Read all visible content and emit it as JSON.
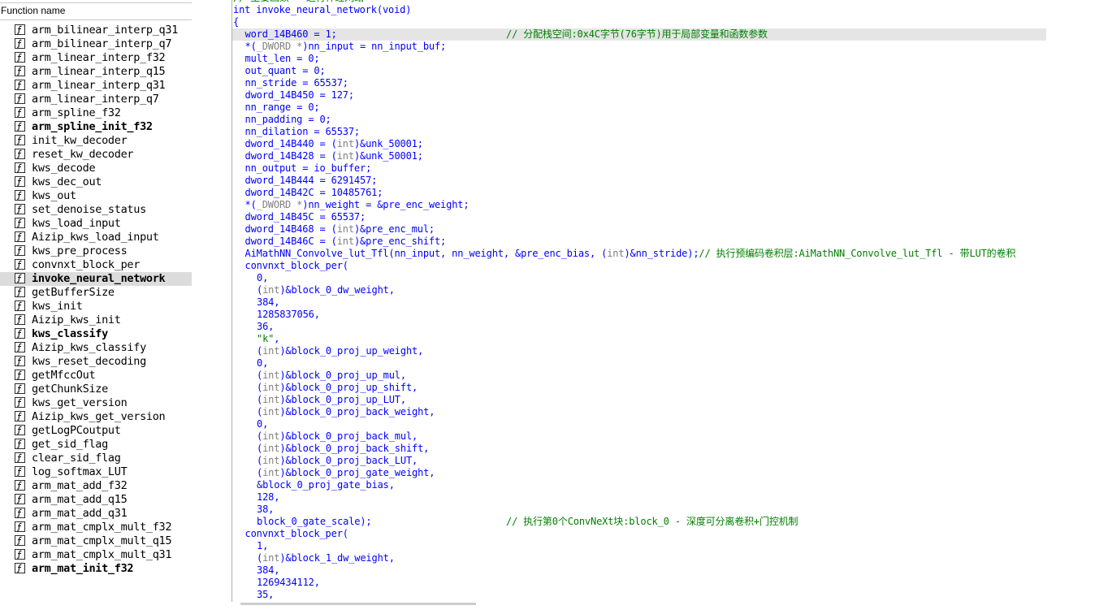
{
  "function_panel": {
    "header": "Function name",
    "items": [
      {
        "name": "arm_bilinear_interp_q31",
        "bold": false,
        "selected": false
      },
      {
        "name": "arm_bilinear_interp_q7",
        "bold": false,
        "selected": false
      },
      {
        "name": "arm_linear_interp_f32",
        "bold": false,
        "selected": false
      },
      {
        "name": "arm_linear_interp_q15",
        "bold": false,
        "selected": false
      },
      {
        "name": "arm_linear_interp_q31",
        "bold": false,
        "selected": false
      },
      {
        "name": "arm_linear_interp_q7",
        "bold": false,
        "selected": false
      },
      {
        "name": "arm_spline_f32",
        "bold": false,
        "selected": false
      },
      {
        "name": "arm_spline_init_f32",
        "bold": true,
        "selected": false
      },
      {
        "name": "init_kw_decoder",
        "bold": false,
        "selected": false
      },
      {
        "name": "reset_kw_decoder",
        "bold": false,
        "selected": false
      },
      {
        "name": "kws_decode",
        "bold": false,
        "selected": false
      },
      {
        "name": "kws_dec_out",
        "bold": false,
        "selected": false
      },
      {
        "name": "kws_out",
        "bold": false,
        "selected": false
      },
      {
        "name": "set_denoise_status",
        "bold": false,
        "selected": false
      },
      {
        "name": "kws_load_input",
        "bold": false,
        "selected": false
      },
      {
        "name": "Aizip_kws_load_input",
        "bold": false,
        "selected": false
      },
      {
        "name": "kws_pre_process",
        "bold": false,
        "selected": false
      },
      {
        "name": "convnxt_block_per",
        "bold": false,
        "selected": false
      },
      {
        "name": "invoke_neural_network",
        "bold": true,
        "selected": true
      },
      {
        "name": "getBufferSize",
        "bold": false,
        "selected": false
      },
      {
        "name": "kws_init",
        "bold": false,
        "selected": false
      },
      {
        "name": "Aizip_kws_init",
        "bold": false,
        "selected": false
      },
      {
        "name": "kws_classify",
        "bold": true,
        "selected": false
      },
      {
        "name": "Aizip_kws_classify",
        "bold": false,
        "selected": false
      },
      {
        "name": "kws_reset_decoding",
        "bold": false,
        "selected": false
      },
      {
        "name": "getMfccOut",
        "bold": false,
        "selected": false
      },
      {
        "name": "getChunkSize",
        "bold": false,
        "selected": false
      },
      {
        "name": "kws_get_version",
        "bold": false,
        "selected": false
      },
      {
        "name": "Aizip_kws_get_version",
        "bold": false,
        "selected": false
      },
      {
        "name": "getLogPCoutput",
        "bold": false,
        "selected": false
      },
      {
        "name": "get_sid_flag",
        "bold": false,
        "selected": false
      },
      {
        "name": "clear_sid_flag",
        "bold": false,
        "selected": false
      },
      {
        "name": "log_softmax_LUT",
        "bold": false,
        "selected": false
      },
      {
        "name": "arm_mat_add_f32",
        "bold": false,
        "selected": false
      },
      {
        "name": "arm_mat_add_q15",
        "bold": false,
        "selected": false
      },
      {
        "name": "arm_mat_add_q31",
        "bold": false,
        "selected": false
      },
      {
        "name": "arm_mat_cmplx_mult_f32",
        "bold": false,
        "selected": false
      },
      {
        "name": "arm_mat_cmplx_mult_q15",
        "bold": false,
        "selected": false
      },
      {
        "name": "arm_mat_cmplx_mult_q31",
        "bold": false,
        "selected": false
      },
      {
        "name": "arm_mat_init_f32",
        "bold": true,
        "selected": false
      }
    ]
  },
  "code_panel": {
    "lines": [
      {
        "indent": 0,
        "parts": [
          {
            "t": "// 主要函数 - 运行神经网络",
            "c": "cmt"
          }
        ]
      },
      {
        "indent": 0,
        "parts": [
          {
            "t": "int invoke_neural_network(void)"
          }
        ]
      },
      {
        "indent": 0,
        "parts": [
          {
            "t": "{"
          }
        ]
      },
      {
        "indent": 2,
        "highlight": true,
        "parts": [
          {
            "t": "word_14B460 = 1;"
          }
        ],
        "comment": "// 分配栈空间:0x4C字节(76字节)用于局部变量和函数参数"
      },
      {
        "indent": 2,
        "parts": [
          {
            "t": "*("
          },
          {
            "t": "_DWORD *",
            "c": "cast"
          },
          {
            "t": ")nn_input = nn_input_buf;"
          }
        ]
      },
      {
        "indent": 2,
        "parts": [
          {
            "t": "mult_len = 0;"
          }
        ]
      },
      {
        "indent": 2,
        "parts": [
          {
            "t": "out_quant = 0;"
          }
        ]
      },
      {
        "indent": 2,
        "parts": [
          {
            "t": "nn_stride = 65537;"
          }
        ]
      },
      {
        "indent": 2,
        "parts": [
          {
            "t": "dword_14B450 = 127;"
          }
        ]
      },
      {
        "indent": 2,
        "parts": [
          {
            "t": "nn_range = 0;"
          }
        ]
      },
      {
        "indent": 2,
        "parts": [
          {
            "t": "nn_padding = 0;"
          }
        ]
      },
      {
        "indent": 2,
        "parts": [
          {
            "t": "nn_dilation = 65537;"
          }
        ]
      },
      {
        "indent": 2,
        "parts": [
          {
            "t": "dword_14B440 = ("
          },
          {
            "t": "int",
            "c": "cast"
          },
          {
            "t": ")&unk_50001;"
          }
        ]
      },
      {
        "indent": 2,
        "parts": [
          {
            "t": "dword_14B428 = ("
          },
          {
            "t": "int",
            "c": "cast"
          },
          {
            "t": ")&unk_50001;"
          }
        ]
      },
      {
        "indent": 2,
        "parts": [
          {
            "t": "nn_output = io_buffer;"
          }
        ]
      },
      {
        "indent": 2,
        "parts": [
          {
            "t": "dword_14B444 = 6291457;"
          }
        ]
      },
      {
        "indent": 2,
        "parts": [
          {
            "t": "dword_14B42C = 10485761;"
          }
        ]
      },
      {
        "indent": 2,
        "parts": [
          {
            "t": "*("
          },
          {
            "t": "_DWORD *",
            "c": "cast"
          },
          {
            "t": ")nn_weight = &pre_enc_weight;"
          }
        ]
      },
      {
        "indent": 2,
        "parts": [
          {
            "t": "dword_14B45C = 65537;"
          }
        ]
      },
      {
        "indent": 2,
        "parts": [
          {
            "t": "dword_14B468 = ("
          },
          {
            "t": "int",
            "c": "cast"
          },
          {
            "t": ")&pre_enc_mul;"
          }
        ]
      },
      {
        "indent": 2,
        "parts": [
          {
            "t": "dword_14B46C = ("
          },
          {
            "t": "int",
            "c": "cast"
          },
          {
            "t": ")&pre_enc_shift;"
          }
        ]
      },
      {
        "indent": 2,
        "parts": [
          {
            "t": "AiMathNN_Convolve_lut_Tfl(nn_input, nn_weight, &pre_enc_bias, ("
          },
          {
            "t": "int",
            "c": "cast"
          },
          {
            "t": ")&nn_stride);"
          },
          {
            "t": "// 执行预编码卷积层:AiMathNN_Convolve_lut_Tfl - 带LUT的卷积",
            "c": "cmt"
          }
        ]
      },
      {
        "indent": 2,
        "parts": [
          {
            "t": "convnxt_block_per("
          }
        ]
      },
      {
        "indent": 4,
        "parts": [
          {
            "t": "0,"
          }
        ]
      },
      {
        "indent": 4,
        "parts": [
          {
            "t": "("
          },
          {
            "t": "int",
            "c": "cast"
          },
          {
            "t": ")&block_0_dw_weight,"
          }
        ]
      },
      {
        "indent": 4,
        "parts": [
          {
            "t": "384,"
          }
        ]
      },
      {
        "indent": 4,
        "parts": [
          {
            "t": "1285837056,"
          }
        ]
      },
      {
        "indent": 4,
        "parts": [
          {
            "t": "36,"
          }
        ]
      },
      {
        "indent": 4,
        "parts": [
          {
            "t": "\"k\"",
            "c": "str"
          },
          {
            "t": ","
          }
        ]
      },
      {
        "indent": 4,
        "parts": [
          {
            "t": "("
          },
          {
            "t": "int",
            "c": "cast"
          },
          {
            "t": ")&block_0_proj_up_weight,"
          }
        ]
      },
      {
        "indent": 4,
        "parts": [
          {
            "t": "0,"
          }
        ]
      },
      {
        "indent": 4,
        "parts": [
          {
            "t": "("
          },
          {
            "t": "int",
            "c": "cast"
          },
          {
            "t": ")&block_0_proj_up_mul,"
          }
        ]
      },
      {
        "indent": 4,
        "parts": [
          {
            "t": "("
          },
          {
            "t": "int",
            "c": "cast"
          },
          {
            "t": ")&block_0_proj_up_shift,"
          }
        ]
      },
      {
        "indent": 4,
        "parts": [
          {
            "t": "("
          },
          {
            "t": "int",
            "c": "cast"
          },
          {
            "t": ")&block_0_proj_up_LUT,"
          }
        ]
      },
      {
        "indent": 4,
        "parts": [
          {
            "t": "("
          },
          {
            "t": "int",
            "c": "cast"
          },
          {
            "t": ")&block_0_proj_back_weight,"
          }
        ]
      },
      {
        "indent": 4,
        "parts": [
          {
            "t": "0,"
          }
        ]
      },
      {
        "indent": 4,
        "parts": [
          {
            "t": "("
          },
          {
            "t": "int",
            "c": "cast"
          },
          {
            "t": ")&block_0_proj_back_mul,"
          }
        ]
      },
      {
        "indent": 4,
        "parts": [
          {
            "t": "("
          },
          {
            "t": "int",
            "c": "cast"
          },
          {
            "t": ")&block_0_proj_back_shift,"
          }
        ]
      },
      {
        "indent": 4,
        "parts": [
          {
            "t": "("
          },
          {
            "t": "int",
            "c": "cast"
          },
          {
            "t": ")&block_0_proj_back_LUT,"
          }
        ]
      },
      {
        "indent": 4,
        "parts": [
          {
            "t": "("
          },
          {
            "t": "int",
            "c": "cast"
          },
          {
            "t": ")&block_0_proj_gate_weight,"
          }
        ]
      },
      {
        "indent": 4,
        "parts": [
          {
            "t": "&block_0_proj_gate_bias,"
          }
        ]
      },
      {
        "indent": 4,
        "parts": [
          {
            "t": "128,"
          }
        ]
      },
      {
        "indent": 4,
        "parts": [
          {
            "t": "38,"
          }
        ]
      },
      {
        "indent": 4,
        "parts": [
          {
            "t": "block_0_gate_scale);"
          }
        ],
        "comment": "// 执行第0个ConvNeXt块:block_0 - 深度可分离卷积+门控机制"
      },
      {
        "indent": 2,
        "parts": [
          {
            "t": "convnxt_block_per("
          }
        ]
      },
      {
        "indent": 4,
        "parts": [
          {
            "t": "1,"
          }
        ]
      },
      {
        "indent": 4,
        "parts": [
          {
            "t": "("
          },
          {
            "t": "int",
            "c": "cast"
          },
          {
            "t": ")&block_1_dw_weight,"
          }
        ]
      },
      {
        "indent": 4,
        "parts": [
          {
            "t": "384,"
          }
        ]
      },
      {
        "indent": 4,
        "parts": [
          {
            "t": "1269434112,"
          }
        ]
      },
      {
        "indent": 4,
        "parts": [
          {
            "t": "35,"
          }
        ]
      }
    ]
  },
  "colors": {
    "code_text": "#0000ff",
    "comment": "#008000",
    "cast": "#808080",
    "highlight": "#e5e5e5",
    "selection": "#dcdcdc"
  },
  "icons": {
    "function_item": "function-f-icon"
  }
}
